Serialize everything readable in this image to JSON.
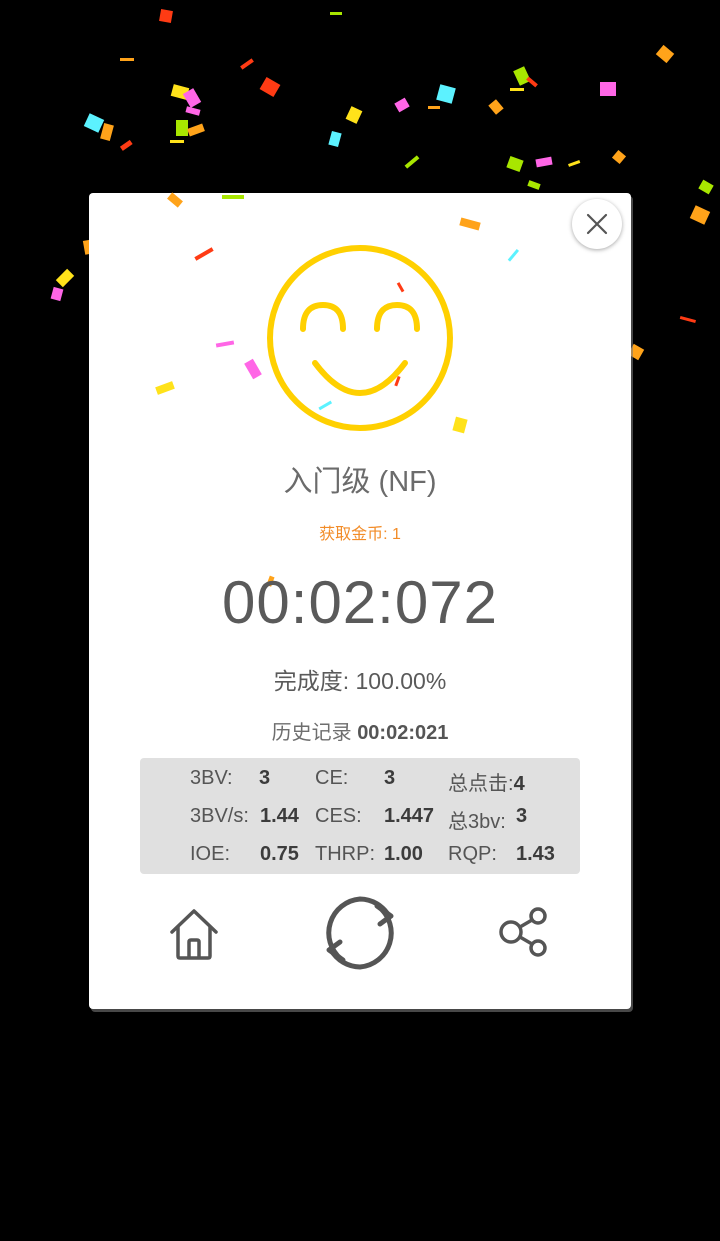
{
  "dialog": {
    "level_title": "入门级 (NF)",
    "coins_text": "获取金币: 1",
    "time": "00:02:072",
    "completion_label": "完成度:",
    "completion_value": "100.00%",
    "history_label": "历史记录",
    "history_value": "00:02:021"
  },
  "stats": [
    {
      "label": "3BV:",
      "value": "3"
    },
    {
      "label": "CE:",
      "value": "3"
    },
    {
      "label": "总点击:",
      "value": "4"
    },
    {
      "label": "3BV/s:",
      "value": "1.44"
    },
    {
      "label": "CES:",
      "value": "1.447"
    },
    {
      "label": "总3bv:",
      "value": "3"
    },
    {
      "label": "IOE:",
      "value": "0.75"
    },
    {
      "label": "THRP:",
      "value": "1.00"
    },
    {
      "label": "RQP:",
      "value": "1.43"
    }
  ],
  "icons": {
    "close": "close-icon",
    "smiley": "smiley-face-icon",
    "home": "home-icon",
    "restart": "restart-icon",
    "share": "share-icon"
  },
  "colors": {
    "smiley": "#FFD000",
    "coins": "#F28C28",
    "icon_gray": "#555555",
    "stats_bg": "#E0E0E0"
  }
}
